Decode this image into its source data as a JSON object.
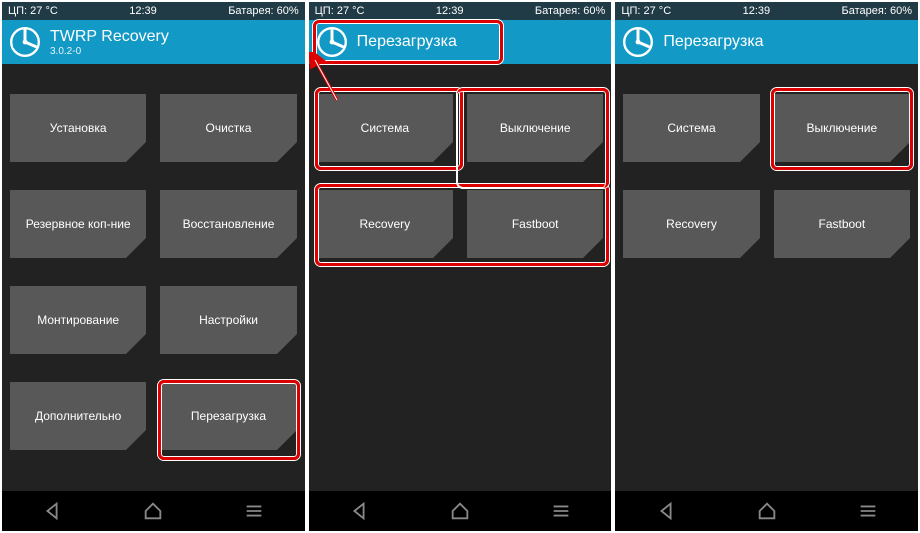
{
  "status": {
    "temp": "ЦП: 27 °C",
    "time": "12:39",
    "battery": "Батарея: 60%"
  },
  "screen1": {
    "title": "TWRP Recovery",
    "version": "3.0.2-0",
    "tiles": [
      "Установка",
      "Очистка",
      "Резервное коп-ние",
      "Восстановление",
      "Монтирование",
      "Настройки",
      "Дополнительно",
      "Перезагрузка"
    ]
  },
  "screen2": {
    "title": "Перезагрузка",
    "tiles": [
      "Система",
      "Выключение",
      "Recovery",
      "Fastboot"
    ]
  },
  "screen3": {
    "title": "Перезагрузка",
    "tiles": [
      "Система",
      "Выключение",
      "Recovery",
      "Fastboot"
    ]
  }
}
